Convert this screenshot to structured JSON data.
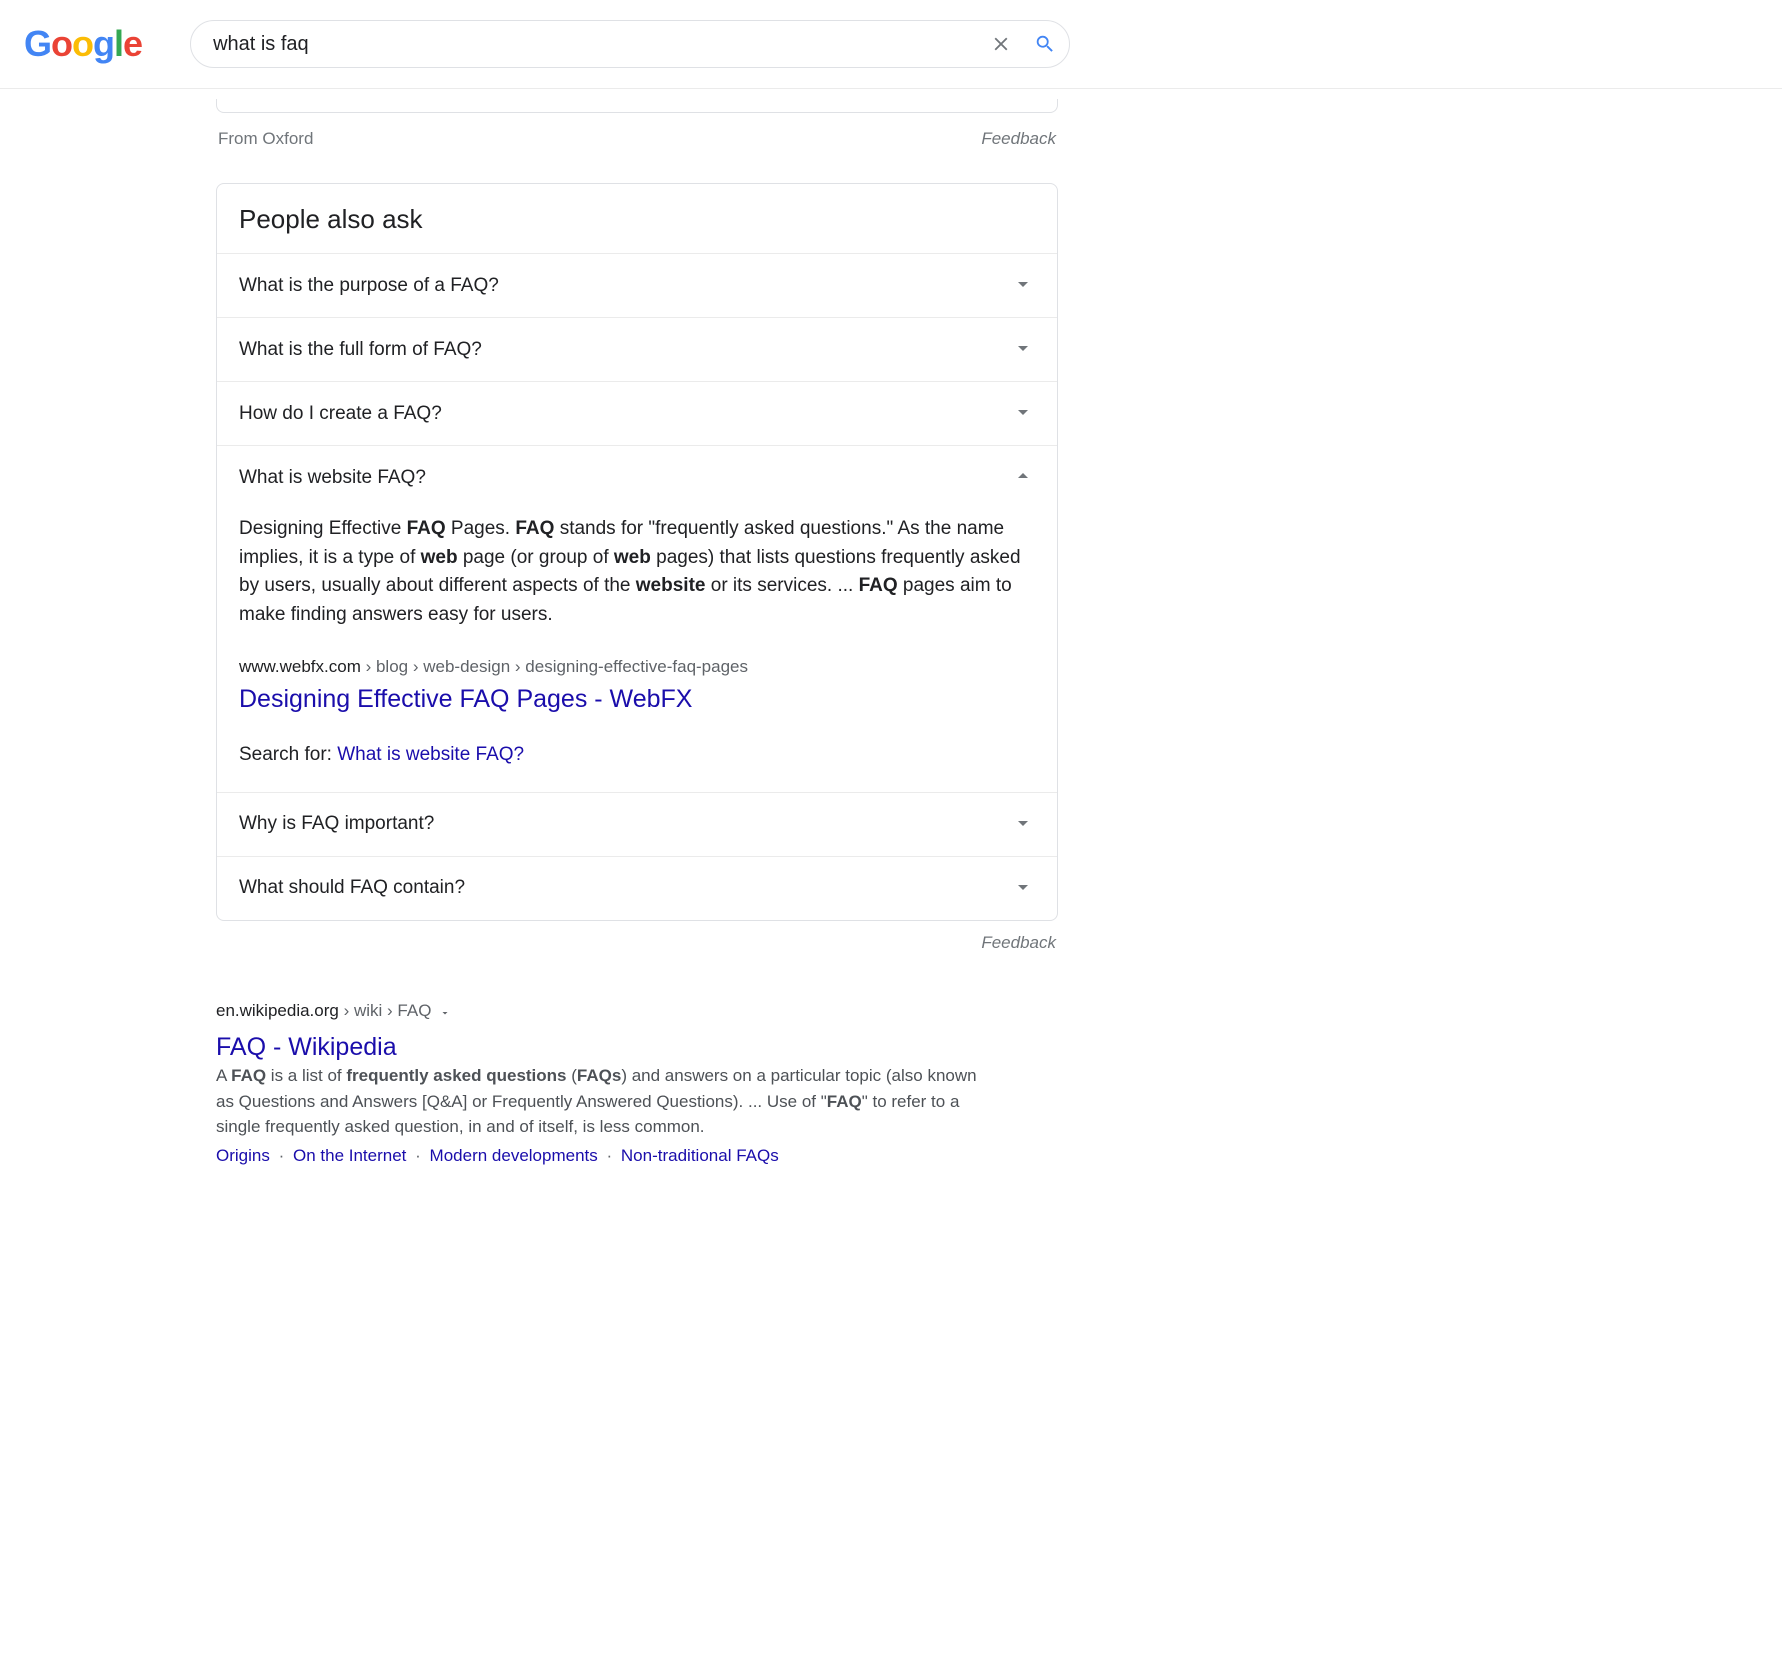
{
  "search": {
    "query": "what is faq"
  },
  "oxford": {
    "label": "From Oxford",
    "feedback": "Feedback"
  },
  "paa": {
    "header": "People also ask",
    "items": [
      {
        "q": "What is the purpose of a FAQ?",
        "expanded": false
      },
      {
        "q": "What is the full form of FAQ?",
        "expanded": false
      },
      {
        "q": "How do I create a FAQ?",
        "expanded": false
      },
      {
        "q": "What is website FAQ?",
        "expanded": true,
        "answer": {
          "pre1": "Designing Effective ",
          "b1": "FAQ",
          "t2": " Pages. ",
          "b2": "FAQ",
          "t3": " stands for \"frequently asked questions.\" As the name implies, it is a type of ",
          "b3": "web",
          "t4": " page (or group of ",
          "b4": "web",
          "t5": " pages) that lists questions frequently asked by users, usually about different aspects of the ",
          "b5": "website",
          "t6": " or its services. ... ",
          "b6": "FAQ",
          "t7": " pages aim to make finding answers easy for users."
        },
        "cite": {
          "domain": "www.webfx.com",
          "path": " › blog › web-design › designing-effective-faq-pages"
        },
        "title": "Designing Effective FAQ Pages - WebFX",
        "searchfor_label": "Search for: ",
        "searchfor_link": "What is website FAQ?"
      },
      {
        "q": "Why is FAQ important?",
        "expanded": false
      },
      {
        "q": "What should FAQ contain?",
        "expanded": false
      }
    ],
    "feedback": "Feedback"
  },
  "organic": {
    "cite": {
      "domain": "en.wikipedia.org",
      "path": " › wiki › FAQ"
    },
    "title": "FAQ - Wikipedia",
    "snippet": {
      "t1": "A ",
      "b1": "FAQ",
      "t2": " is a list of ",
      "b2": "frequently asked questions",
      "t3": " (",
      "b3": "FAQs",
      "t4": ") and answers on a particular topic (also known as Questions and Answers [Q&A] or Frequently Answered Questions). ... Use of \"",
      "b4": "FAQ",
      "t5": "\" to refer to a single frequently asked question, in and of itself, is less common."
    },
    "sitelinks": [
      "Origins",
      "On the Internet",
      "Modern developments",
      "Non-traditional FAQs"
    ]
  }
}
